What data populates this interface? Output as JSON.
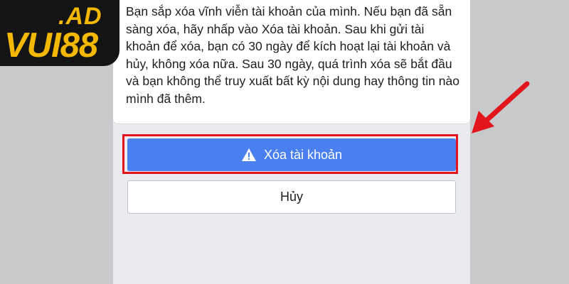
{
  "dialog": {
    "message": "Bạn sắp xóa vĩnh viễn tài khoản của mình. Nếu bạn đã sẵn sàng xóa, hãy nhấp vào Xóa tài khoản. Sau khi gửi tài khoản để xóa, bạn có 30 ngày để kích hoạt lại tài khoản và hủy, không xóa nữa. Sau 30 ngày, quá trình xóa sẽ bắt đầu và bạn không thể truy xuất bất kỳ nội dung hay thông tin nào mình đã thêm."
  },
  "actions": {
    "delete_label": "Xóa tài khoản",
    "delete_icon": "warning-triangle-icon",
    "cancel_label": "Hủy"
  },
  "watermark": {
    "ad": ".AD",
    "main": "VUI88"
  },
  "colors": {
    "primary_button": "#4a7ff0",
    "highlight": "#e3151c",
    "logo_gold": "#f5b800",
    "logo_bg": "#141414"
  }
}
